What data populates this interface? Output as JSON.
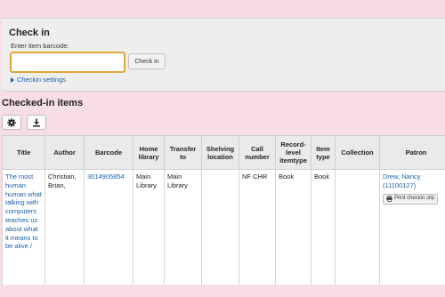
{
  "checkin": {
    "title": "Check in",
    "barcode_label": "Enter item barcode:",
    "barcode_value": "",
    "button_label": "Check in",
    "settings_link": "Checkin settings"
  },
  "checked_in": {
    "title": "Checked-in items",
    "toolbar": {
      "settings_icon": "gear-icon",
      "export_icon": "download-icon"
    },
    "columns": [
      "Title",
      "Author",
      "Barcode",
      "Home library",
      "Transfer to",
      "Shelving location",
      "Call number",
      "Record-level itemtype",
      "Item type",
      "Collection",
      "Patron"
    ],
    "rows": [
      {
        "title": "The most human human what talking with computers teaches us about what it means to be alive /",
        "author": "Christian, Brian,",
        "barcode": "3014905854",
        "home_library": "Main Library",
        "transfer_to": "Main Library",
        "shelving_location": "",
        "call_number": "NF CHR",
        "record_itemtype": "Book",
        "item_type": "Book",
        "collection": "",
        "patron_name": "Drew, Nancy",
        "patron_card": "(11100127)",
        "print_slip_label": "Print checkin slip"
      }
    ]
  },
  "colors": {
    "accent": "#1b5fa8",
    "background": "#f7dde4",
    "focus": "#e0a63a"
  }
}
